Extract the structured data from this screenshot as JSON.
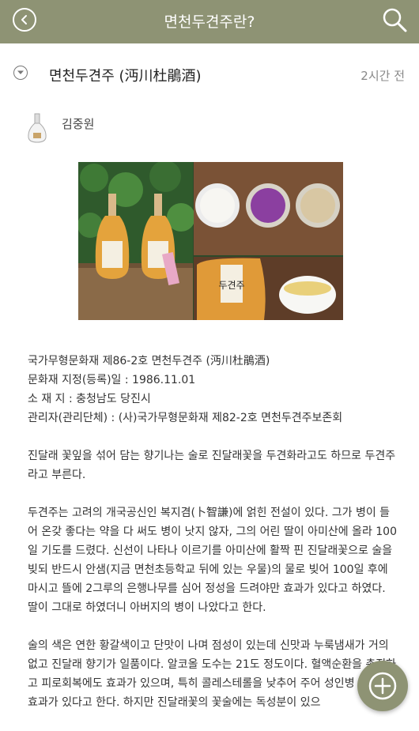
{
  "header": {
    "title": "면천두견주란?",
    "back_icon": "back-arrow-icon",
    "search_icon": "search-icon",
    "bar_color": "#8e9374"
  },
  "post": {
    "title": "면천두견주 (沔川杜鵑酒)",
    "time": "2시간 전",
    "author": "김중원",
    "photo_label": "두견주",
    "meta": [
      "국가무형문화재 제86-2호 면천두견주 (沔川杜鵑酒)",
      "문화재 지정(등록)일 : 1986.11.01",
      "소 재 지 : 충청남도 당진시",
      "관리자(관리단체) : (사)국가무형문화재 제82-2호 면천두견주보존회"
    ],
    "paragraphs": [
      "진달래 꽃잎을 섞어 담는 향기나는 술로 진달래꽃을 두견화라고도 하므로 두견주라고 부른다.",
      "두견주는 고려의 개국공신인 복지겸(卜智謙)에 얽힌 전설이 있다. 그가 병이 들어 온갖 좋다는 약을 다 써도 병이 낫지 않자, 그의 어린 딸이 아미산에 올라 100일 기도를 드렸다. 신선이 나타나 이르기를 아미산에 활짝 핀 진달래꽃으로 술을 빚되 반드시 안샘(지금 면천초등학교 뒤에 있는 우물)의 물로 빚어 100일 후에 마시고 뜰에 2그루의 은행나무를 심어 정성을 드려야만 효과가 있다고 하였다. 딸이 그대로 하였더니 아버지의 병이 나았다고 한다.",
      "술의 색은 연한 황갈색이고 단맛이 나며 점성이 있는데 신맛과 누룩냄새가 거의 없고 진달래 향기가 일품이다. 알코올 도수는 21도 정도이다. 혈액순환을 촉진하고 피로회복에도 효과가 있으며, 특히 콜레스테롤을 낮추어 주어 성인병 예방에도 효과가 있다고 한다. 하지만 진달래꽃의 꽃술에는 독성분이 있으"
    ]
  },
  "fab": {
    "icon": "add-icon"
  }
}
